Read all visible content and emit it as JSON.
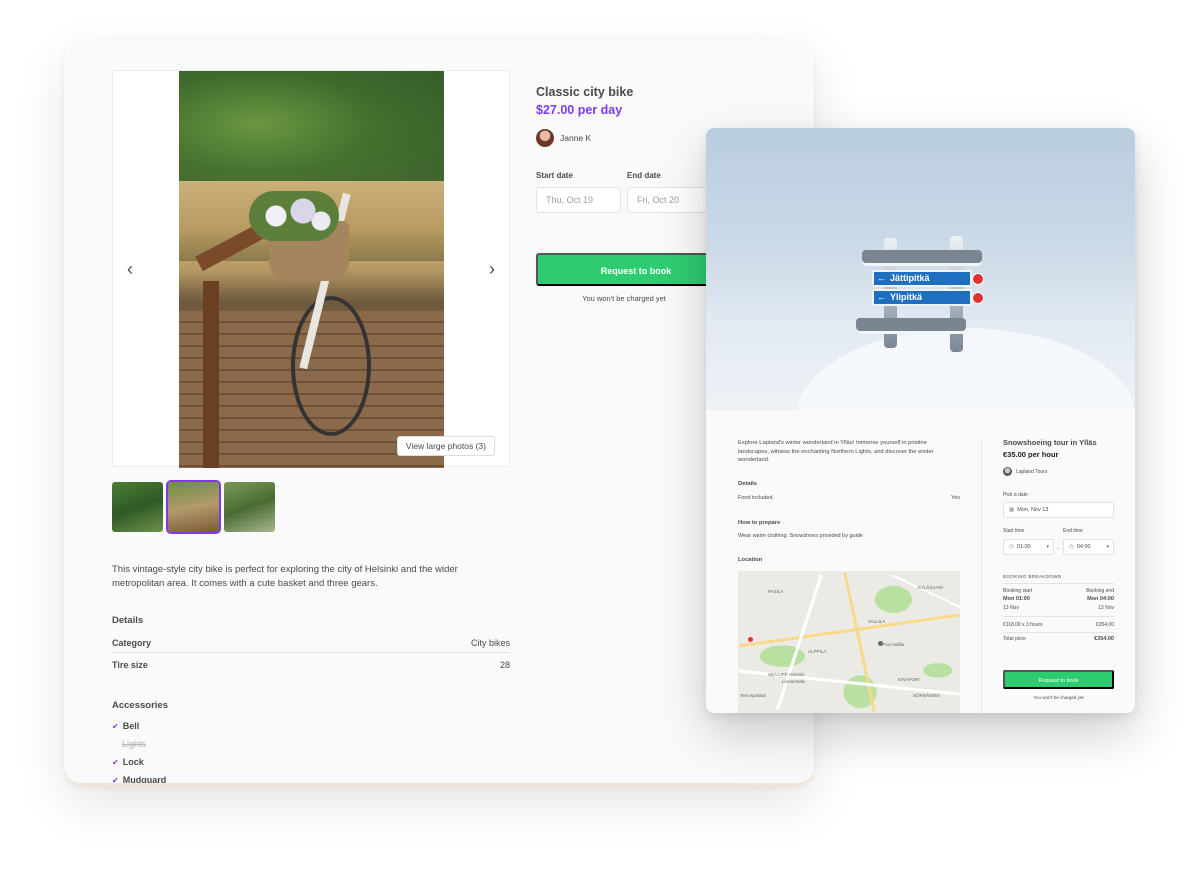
{
  "listing_bike": {
    "title": "Classic city bike",
    "price": "$27.00 per day",
    "author": "Janne K",
    "start_date_label": "Start date",
    "end_date_label": "End date",
    "start_date_placeholder": "Thu, Oct 19",
    "end_date_placeholder": "Fri, Oct 20",
    "book_button": "Request to book",
    "no_charge_note": "You won't be charged yet",
    "view_photos_button": "View large photos (3)",
    "prev_arrow": "‹",
    "next_arrow": "›",
    "description": "This vintage-style city bike is perfect for exploring the city of Helsinki and the wider metropolitan area. It comes with a cute basket and three gears.",
    "details_heading": "Details",
    "details": [
      {
        "key": "Category",
        "value": "City bikes"
      },
      {
        "key": "Tire size",
        "value": "28"
      }
    ],
    "accessories_heading": "Accessories",
    "accessories": [
      {
        "label": "Bell",
        "included": true
      },
      {
        "label": "Lights",
        "included": false
      },
      {
        "label": "Lock",
        "included": true
      },
      {
        "label": "Mudguard",
        "included": true
      }
    ],
    "check_symbol": "✔",
    "accent_color": "#7c3aed"
  },
  "listing_tour": {
    "title": "Snowshoeing tour in Ylläs",
    "price": "€35.00 per hour",
    "author": "Lapland Tours",
    "sign_1": "Jättipitkä",
    "sign_2": "Ylipitkä",
    "description": "Explore Lapland's winter wonderland in Ylläs! Immerse yourself in pristine landscapes, witness the enchanting Northern Lights, and discover the winter wonderland.",
    "details_heading": "Details",
    "details": [
      {
        "key": "Food included",
        "value": "Yes"
      }
    ],
    "prepare_heading": "How to prepare",
    "prepare_text": "Wear warm clothing. Snowshoes provided by guide",
    "location_heading": "Location",
    "map_labels": [
      "PASILA",
      "VALLILA",
      "ALPPILA",
      "KYLÄSAARI",
      "SEA LIFE Helsinki",
      "Linnanmäki",
      "Puu-Vallila",
      "KINAPORI",
      "SÖRNÄINEN",
      "Tennispalatsi"
    ],
    "pick_date_label": "Pick a date",
    "date_value": "Mon, Nov 13",
    "start_time_label": "Start time",
    "end_time_label": "End time",
    "start_time_value": "01:00",
    "end_time_value": "04:00",
    "time_separator": "-",
    "breakdown_heading": "BOOKING BREAKDOWN",
    "booking_start_label": "Booking start",
    "booking_end_label": "Booking end",
    "booking_start_time": "Mon 01:00",
    "booking_end_time": "Mon 04:00",
    "booking_start_date": "13 Nov",
    "booking_end_date": "13 Nov",
    "line_item_label": "€118.00 x 3 hours",
    "line_item_value": "€354.00",
    "total_label": "Total price",
    "total_value": "€354.00",
    "book_button": "Request to book",
    "no_charge_note": "You won't be charged yet",
    "accent_color": "#2ecc71"
  }
}
